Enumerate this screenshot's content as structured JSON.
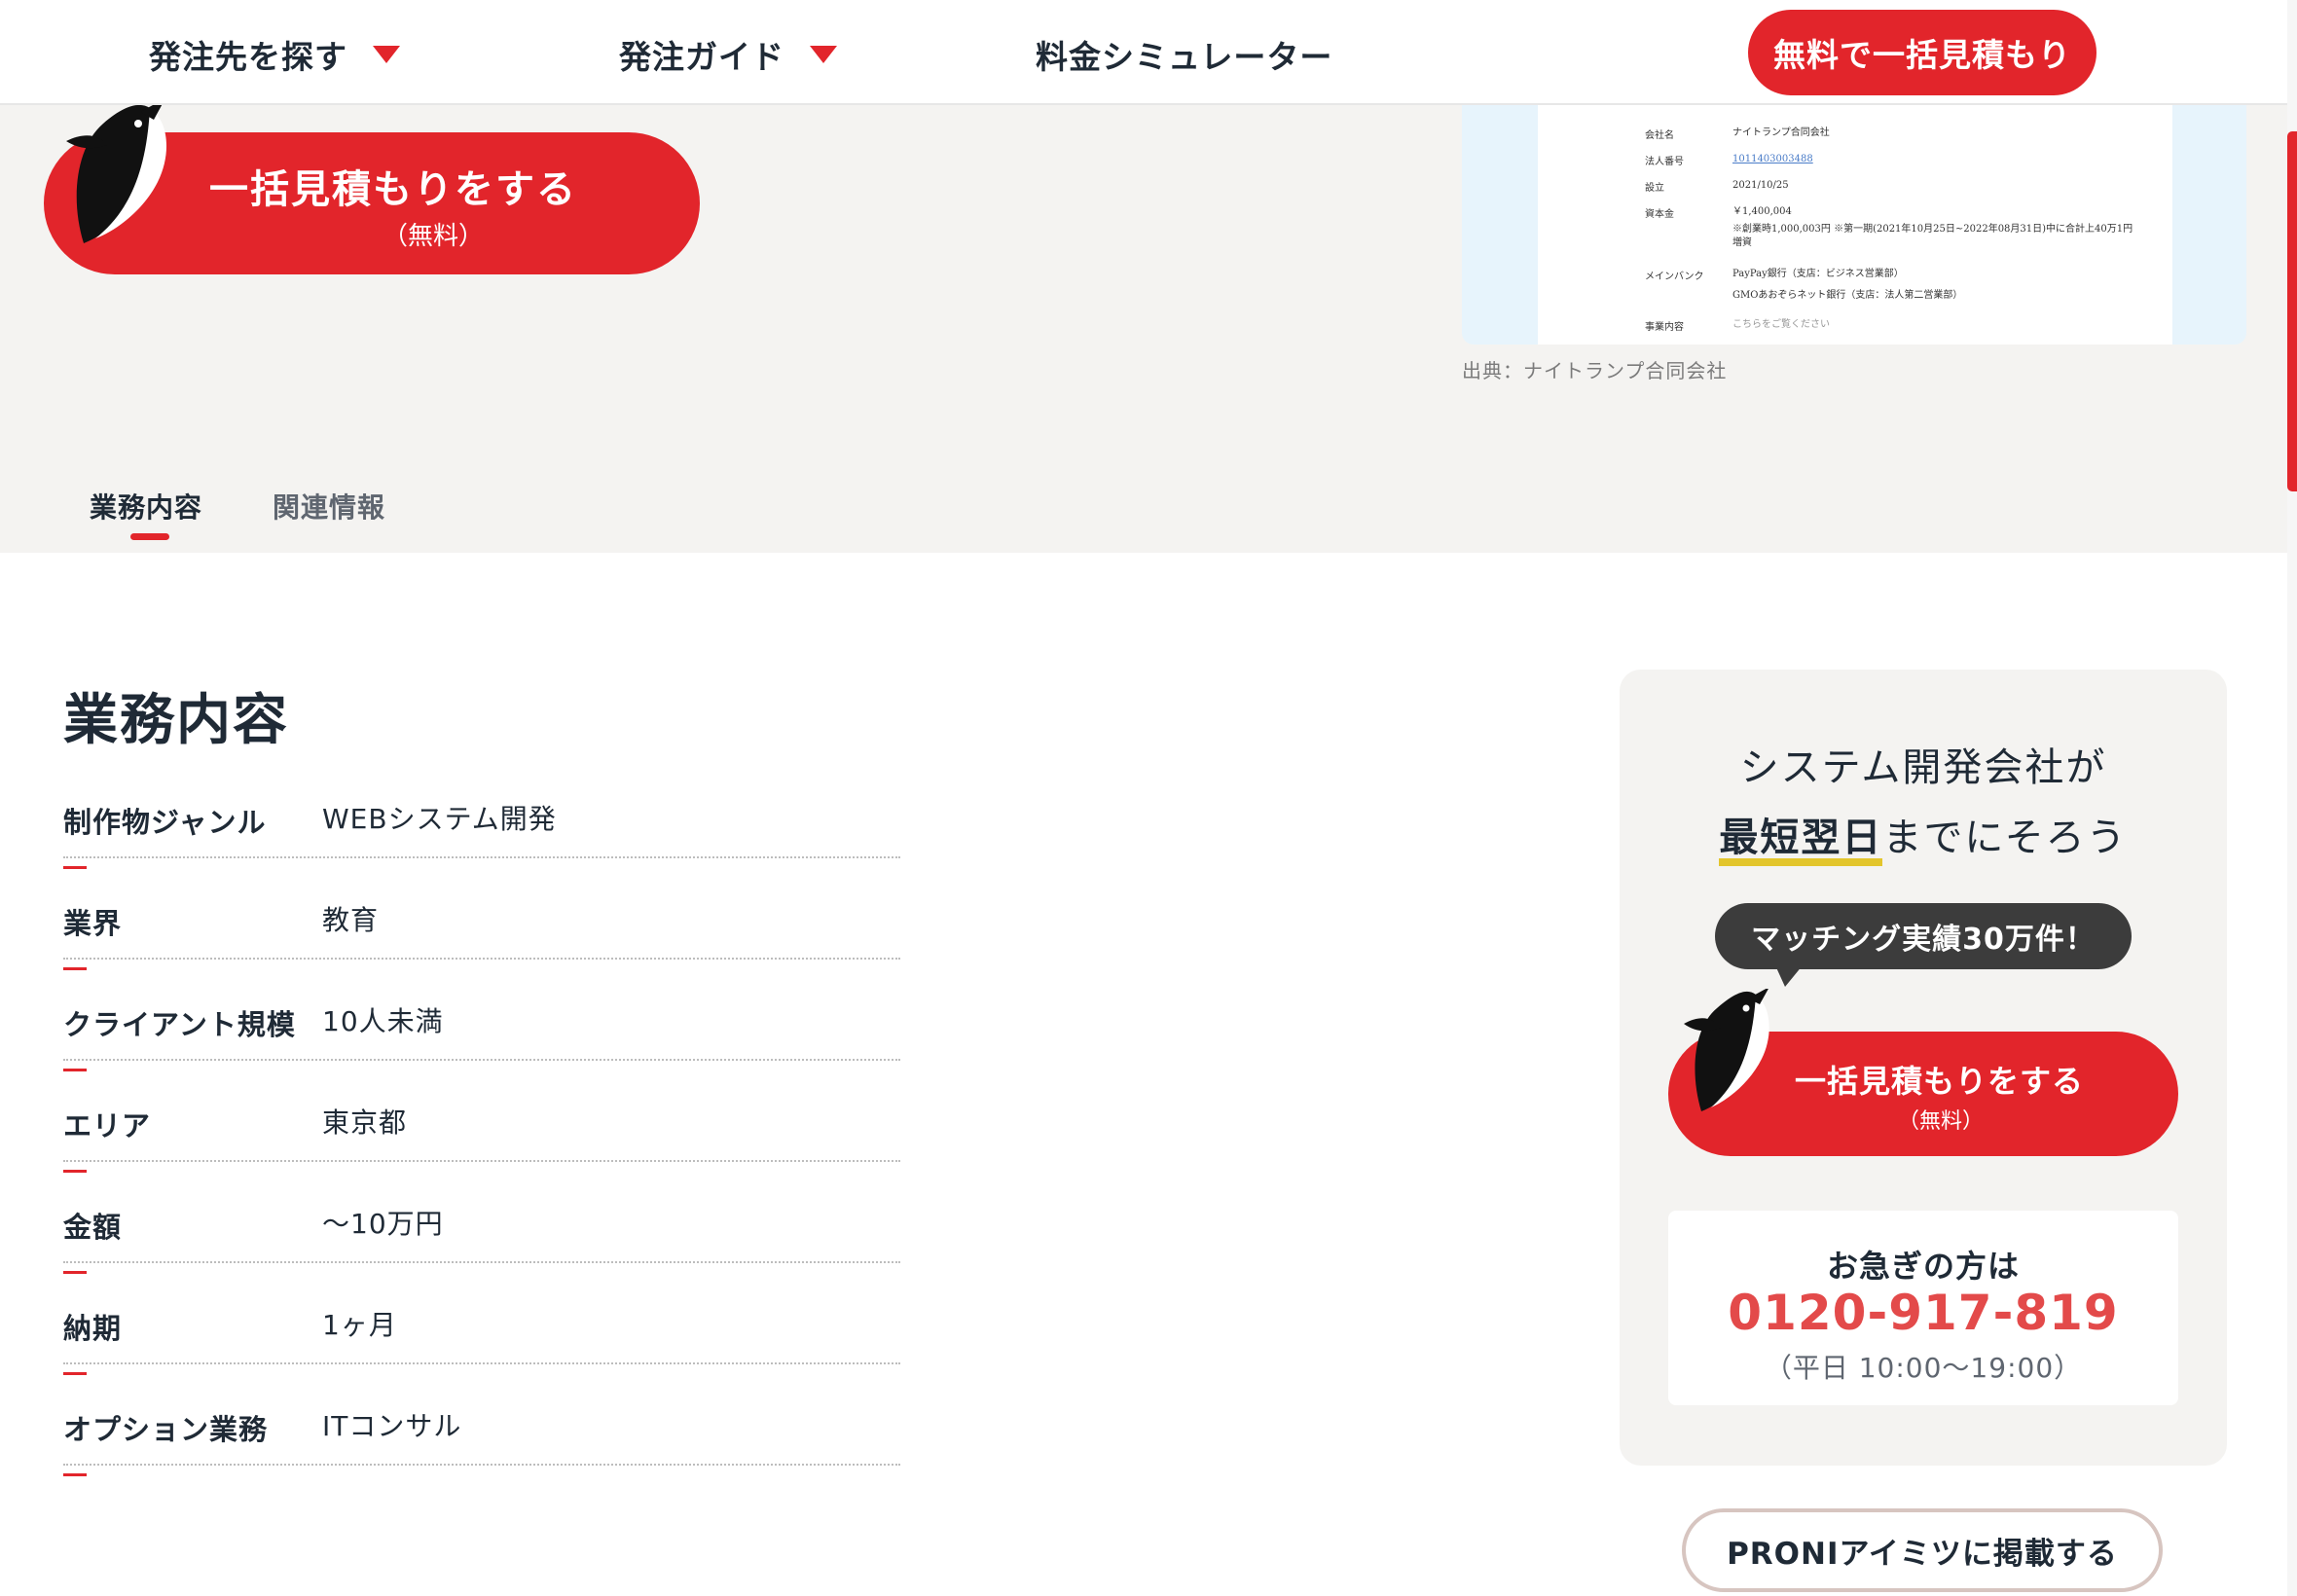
{
  "header": {
    "nav": [
      {
        "label": "発注先を探す",
        "has_dropdown": true
      },
      {
        "label": "発注ガイド",
        "has_dropdown": true
      },
      {
        "label": "料金シミュレーター",
        "has_dropdown": false
      }
    ],
    "cta_label": "無料で一括見積もり"
  },
  "hero": {
    "cta_line1": "一括見積もりをする",
    "cta_line2": "（無料）",
    "company_doc": [
      {
        "key": "会社名",
        "value": "ナイトランプ合同会社"
      },
      {
        "key": "法人番号",
        "value": "1011403003488"
      },
      {
        "key": "設立",
        "value": "2021/10/25"
      },
      {
        "key": "資本金",
        "value": "￥1,400,004"
      },
      {
        "key": "",
        "value": "※創業時1,000,003円 ※第一期(2021年10月25日~2022年08月31日)中に合計上40万1円増資"
      },
      {
        "key": "メインバンク",
        "value": "PayPay銀行（支店：ビジネス営業部）"
      },
      {
        "key": "",
        "value": "GMOあおぞらネット銀行（支店：法人第二営業部）"
      },
      {
        "key": "事業内容",
        "value": "こちらをご覧ください"
      }
    ],
    "source": "出典：ナイトランプ合同会社"
  },
  "tabs": [
    {
      "label": "業務内容",
      "active": true
    },
    {
      "label": "関連情報",
      "active": false
    }
  ],
  "main": {
    "title": "業務内容",
    "rows": [
      {
        "label": "制作物ジャンル",
        "value": "WEBシステム開発"
      },
      {
        "label": "業界",
        "value": "教育"
      },
      {
        "label": "クライアント規模",
        "value": "10人未満"
      },
      {
        "label": "エリア",
        "value": "東京都"
      },
      {
        "label": "金額",
        "value": "〜10万円"
      },
      {
        "label": "納期",
        "value": "1ヶ月"
      },
      {
        "label": "オプション業務",
        "value": "ITコンサル"
      }
    ]
  },
  "sidebar": {
    "line1": "システム開発会社が",
    "line2_highlight": "最短翌日",
    "line2_rest": "までにそろう",
    "bubble": "マッチング実績30万件！",
    "cta_line1": "一括見積もりをする",
    "cta_line2": "（無料）",
    "phone_title": "お急ぎの方は",
    "phone_number": "0120-917-819",
    "phone_hours": "（平日 10:00〜19:00）"
  },
  "proni_button": "PRONIアイミツに掲載する",
  "colors": {
    "accent": "#e2252b",
    "phone": "#e34a4a",
    "highlight": "#e3c52c",
    "panel": "#f4f3f1"
  }
}
